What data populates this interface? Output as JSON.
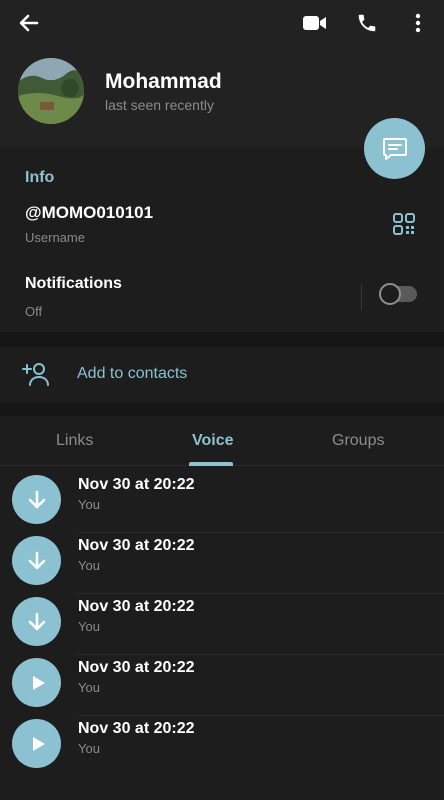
{
  "header": {
    "name": "Mohammad",
    "status": "last seen recently",
    "icons": [
      "back-arrow-icon",
      "video-call-icon",
      "phone-icon",
      "more-vertical-icon"
    ]
  },
  "info": {
    "title": "Info",
    "username": "@MOMO010101",
    "username_label": "Username",
    "notifications_title": "Notifications",
    "notifications_status": "Off",
    "notifications_enabled": false
  },
  "contacts": {
    "add_label": "Add to contacts"
  },
  "tabs": [
    {
      "label": "Links",
      "active": false
    },
    {
      "label": "Voice",
      "active": true
    },
    {
      "label": "Groups",
      "active": false
    }
  ],
  "voice_items": [
    {
      "title": "Nov 30 at 20:22",
      "sender": "You",
      "state": "download"
    },
    {
      "title": "Nov 30 at 20:22",
      "sender": "You",
      "state": "download"
    },
    {
      "title": "Nov 30 at 20:22",
      "sender": "You",
      "state": "download"
    },
    {
      "title": "Nov 30 at 20:22",
      "sender": "You",
      "state": "play"
    },
    {
      "title": "Nov 30 at 20:22",
      "sender": "You",
      "state": "play"
    }
  ],
  "colors": {
    "accent": "#8cc1d2",
    "header_bg": "#222222",
    "panel_bg": "#1d1d1d",
    "page_bg": "#161616"
  }
}
